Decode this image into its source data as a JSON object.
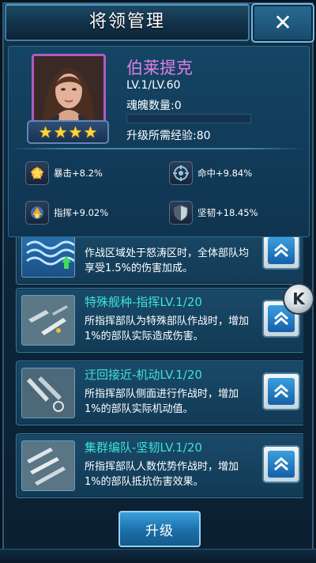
{
  "header": {
    "title": "将领管理",
    "close_label": "✕"
  },
  "hero": {
    "name": "伯莱提克",
    "level": "LV.1/LV.60",
    "soul_count": "魂魄数量:0",
    "exp_progress": 0,
    "exp_required": "升级所需经验:80",
    "stars": 4
  },
  "stats": [
    {
      "icon": "critical-icon",
      "label": "暴击+8.2%"
    },
    {
      "icon": "accuracy-icon",
      "label": "命中+9.84%"
    },
    {
      "icon": "command-icon",
      "label": "指挥+9.02%"
    },
    {
      "icon": "toughness-icon",
      "label": "坚韧+18.45%"
    }
  ],
  "skills": [
    {
      "title": "",
      "desc": "作战区域处于怒涛区时，全体部队均享受1.5%的伤害加成。"
    },
    {
      "title": "特殊舰种-指挥LV.1/20",
      "desc": "所指挥部队为特殊部队作战时，增加1%的部队实际造成伤害。"
    },
    {
      "title": "迂回接近-机动LV.1/20",
      "desc": "所指挥部队侧面进行作战时，增加1%的部队实际机动值。"
    },
    {
      "title": "集群编队-坚韧LV.1/20",
      "desc": "所指挥部队人数优势作战时，增加1%的部队抵抗伤害效果。"
    }
  ],
  "side_badge": "K",
  "upgrade_button": "升级",
  "colors": {
    "accent": "#3ee2d6",
    "hero_name": "#e37de8",
    "star": "#ffd63a"
  }
}
